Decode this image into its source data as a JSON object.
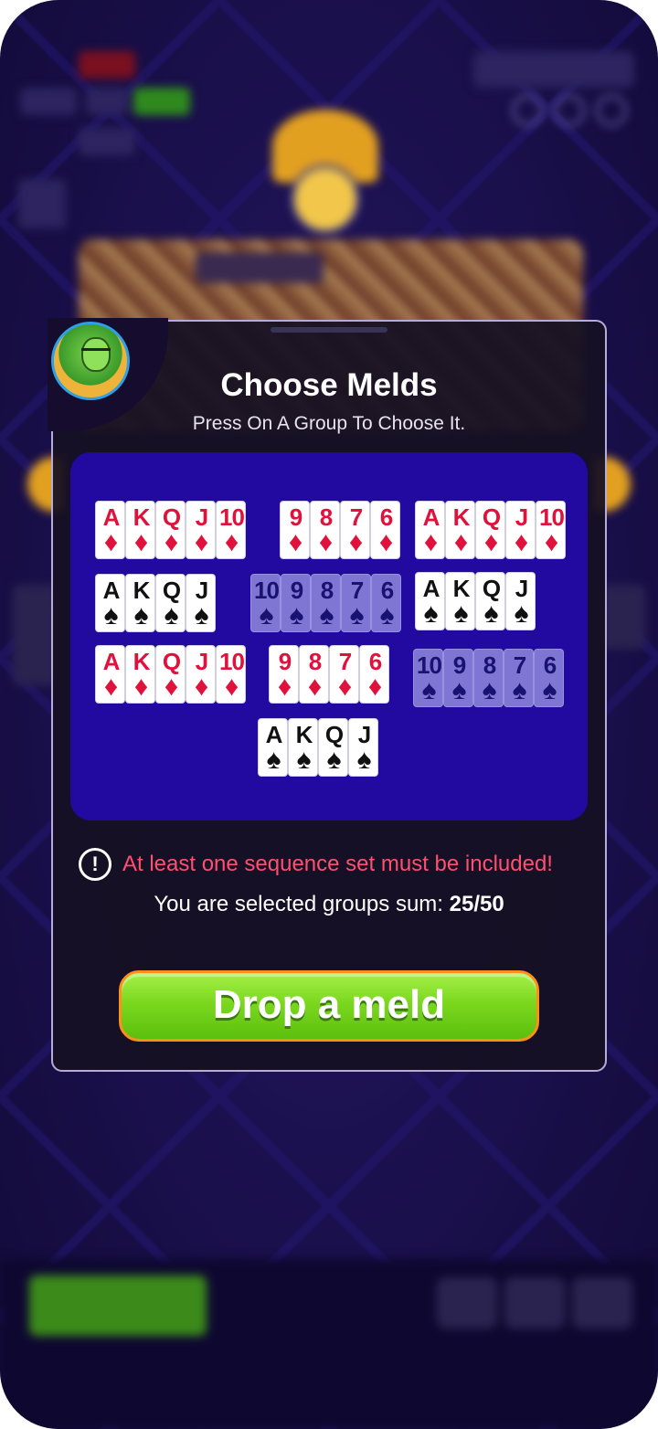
{
  "modal": {
    "title": "Choose Melds",
    "subtitle": "Press On A Group  To Choose It.",
    "warning": "At least one sequence set must be included!",
    "sum_label": "You are selected groups sum: ",
    "sum_value": "25/50",
    "drop_button": "Drop a meld"
  },
  "groups": [
    {
      "suit": "diamond",
      "selected": true,
      "ranks": [
        "A",
        "K",
        "Q",
        "J",
        "10"
      ]
    },
    {
      "suit": "diamond",
      "selected": true,
      "ranks": [
        "9",
        "8",
        "7",
        "6"
      ]
    },
    {
      "suit": "diamond",
      "selected": true,
      "ranks": [
        "A",
        "K",
        "Q",
        "J",
        "10"
      ]
    },
    {
      "suit": "spade",
      "selected": true,
      "ranks": [
        "A",
        "K",
        "Q",
        "J"
      ]
    },
    {
      "suit": "spade",
      "selected": false,
      "ranks": [
        "10",
        "9",
        "8",
        "7",
        "6"
      ]
    },
    {
      "suit": "spade",
      "selected": true,
      "ranks": [
        "A",
        "K",
        "Q",
        "J"
      ]
    },
    {
      "suit": "diamond",
      "selected": true,
      "ranks": [
        "A",
        "K",
        "Q",
        "J",
        "10"
      ]
    },
    {
      "suit": "diamond",
      "selected": true,
      "ranks": [
        "9",
        "8",
        "7",
        "6"
      ]
    },
    {
      "suit": "spade",
      "selected": false,
      "ranks": [
        "10",
        "9",
        "8",
        "7",
        "6"
      ]
    },
    {
      "suit": "spade",
      "selected": true,
      "ranks": [
        "A",
        "K",
        "Q",
        "J"
      ]
    }
  ],
  "colors": {
    "panel": "#2209a0",
    "warning": "#ff4f6e",
    "button_green": "#7bd81e",
    "button_border": "#ff8f1a",
    "red_suit": "#e0123c"
  },
  "icons": {
    "warning": "exclamation-circle-icon",
    "diamond": "♦",
    "spade": "♠"
  }
}
